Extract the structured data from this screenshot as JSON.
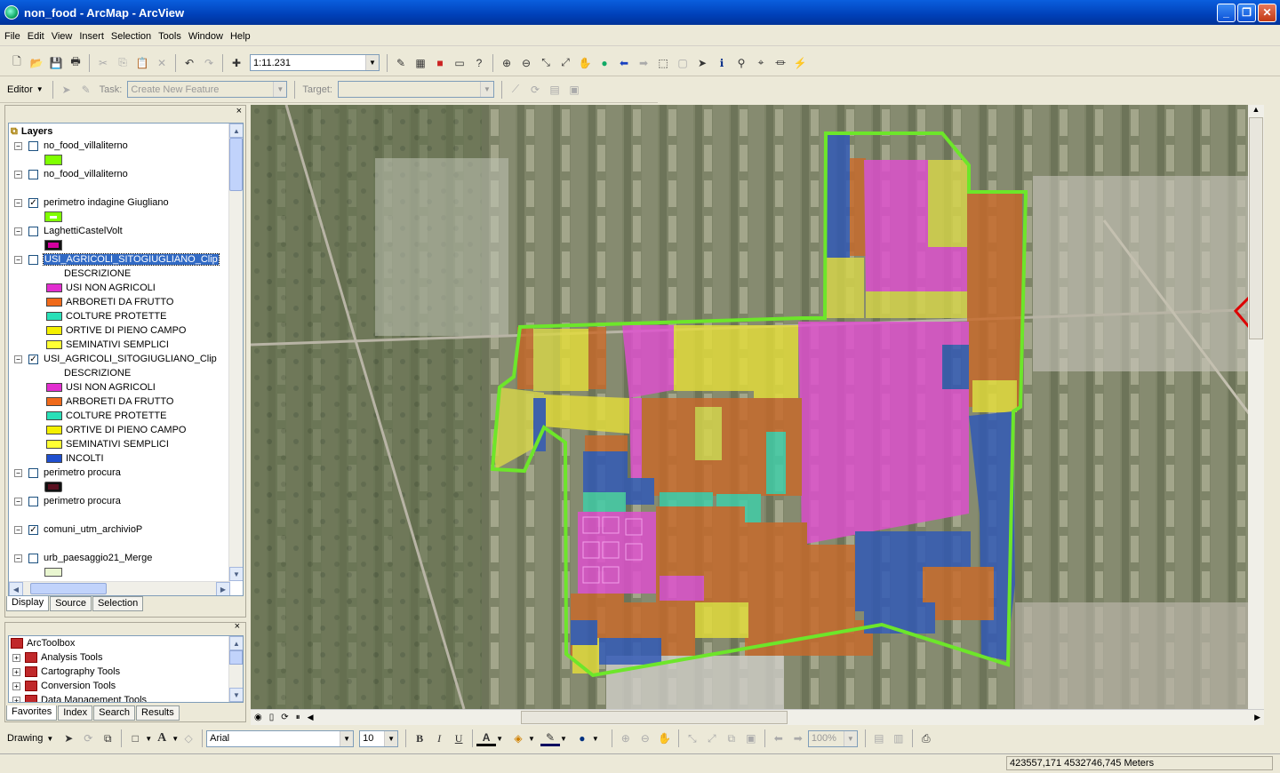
{
  "window": {
    "title": "non_food - ArcMap - ArcView",
    "minimize": "_",
    "maximize": "❐",
    "close": "✕"
  },
  "menu": [
    "File",
    "Edit",
    "View",
    "Insert",
    "Selection",
    "Tools",
    "Window",
    "Help"
  ],
  "standard_toolbar": {
    "scale": "1:11.231"
  },
  "editor_toolbar": {
    "editor_label": "Editor",
    "task_label": "Task:",
    "task_value": "Create New Feature",
    "target_label": "Target:",
    "target_value": ""
  },
  "toc": {
    "root": "Layers",
    "close": "×",
    "layers": [
      {
        "name": "no_food_villaliterno",
        "checked": false,
        "swatch": "#7fff00"
      },
      {
        "name": "no_food_villaliterno",
        "checked": false
      },
      {
        "name": "perimetro indagine Giugliano",
        "checked": true,
        "swatch": "#7fff00"
      },
      {
        "name": "LaghettiCastelVolt",
        "checked": false,
        "swatch": "#d400a0"
      },
      {
        "name": "USI_AGRICOLI_SITOGIUGLIANO_Clip",
        "checked": false,
        "selected": true,
        "field": "DESCRIZIONE",
        "classes": [
          {
            "label": "USI NON AGRICOLI",
            "color": "#e22ed0"
          },
          {
            "label": "ARBORETI DA FRUTTO",
            "color": "#f06a1a"
          },
          {
            "label": "COLTURE PROTETTE",
            "color": "#29e0b8"
          },
          {
            "label": "ORTIVE DI PIENO CAMPO",
            "color": "#f4f000"
          },
          {
            "label": "SEMINATIVI SEMPLICI",
            "color": "#ffff33"
          }
        ]
      },
      {
        "name": "USI_AGRICOLI_SITOGIUGLIANO_Clip",
        "checked": true,
        "field": "DESCRIZIONE",
        "classes": [
          {
            "label": "USI NON AGRICOLI",
            "color": "#e22ed0"
          },
          {
            "label": "ARBORETI DA FRUTTO",
            "color": "#f06a1a"
          },
          {
            "label": "COLTURE PROTETTE",
            "color": "#29e0b8"
          },
          {
            "label": "ORTIVE DI PIENO CAMPO",
            "color": "#f4f000"
          },
          {
            "label": "SEMINATIVI SEMPLICI",
            "color": "#ffff33"
          },
          {
            "label": "INCOLTI",
            "color": "#1f4fcf"
          }
        ]
      },
      {
        "name": "perimetro procura",
        "checked": false,
        "swatch": "#5a1020"
      },
      {
        "name": "perimetro procura",
        "checked": false
      },
      {
        "name": "comuni_utm_archivioP",
        "checked": true
      },
      {
        "name": "urb_paesaggio21_Merge",
        "checked": false,
        "swatch": "#e9f6d0"
      }
    ],
    "tabs": [
      "Display",
      "Source",
      "Selection"
    ]
  },
  "toolbox": {
    "root": "ArcToolbox",
    "items": [
      "Analysis Tools",
      "Cartography Tools",
      "Conversion Tools",
      "Data Management Tools"
    ],
    "tabs": [
      "Favorites",
      "Index",
      "Search",
      "Results"
    ]
  },
  "drawing_toolbar": {
    "drawing_label": "Drawing",
    "font": "Arial",
    "size": "10",
    "bold": "B",
    "italic": "I",
    "underline": "U",
    "zoom": "100%"
  },
  "status": {
    "coords": "423557,171  4532746,745 Meters"
  },
  "map_colors": {
    "non_agricoli": "#e04fd0",
    "arboreti": "#c86a2a",
    "protette": "#3fcfa9",
    "ortive": "#e4dd3a",
    "seminativi": "#d7d64a",
    "incolti": "#2f58b8",
    "perimeter": "#6de62a"
  }
}
